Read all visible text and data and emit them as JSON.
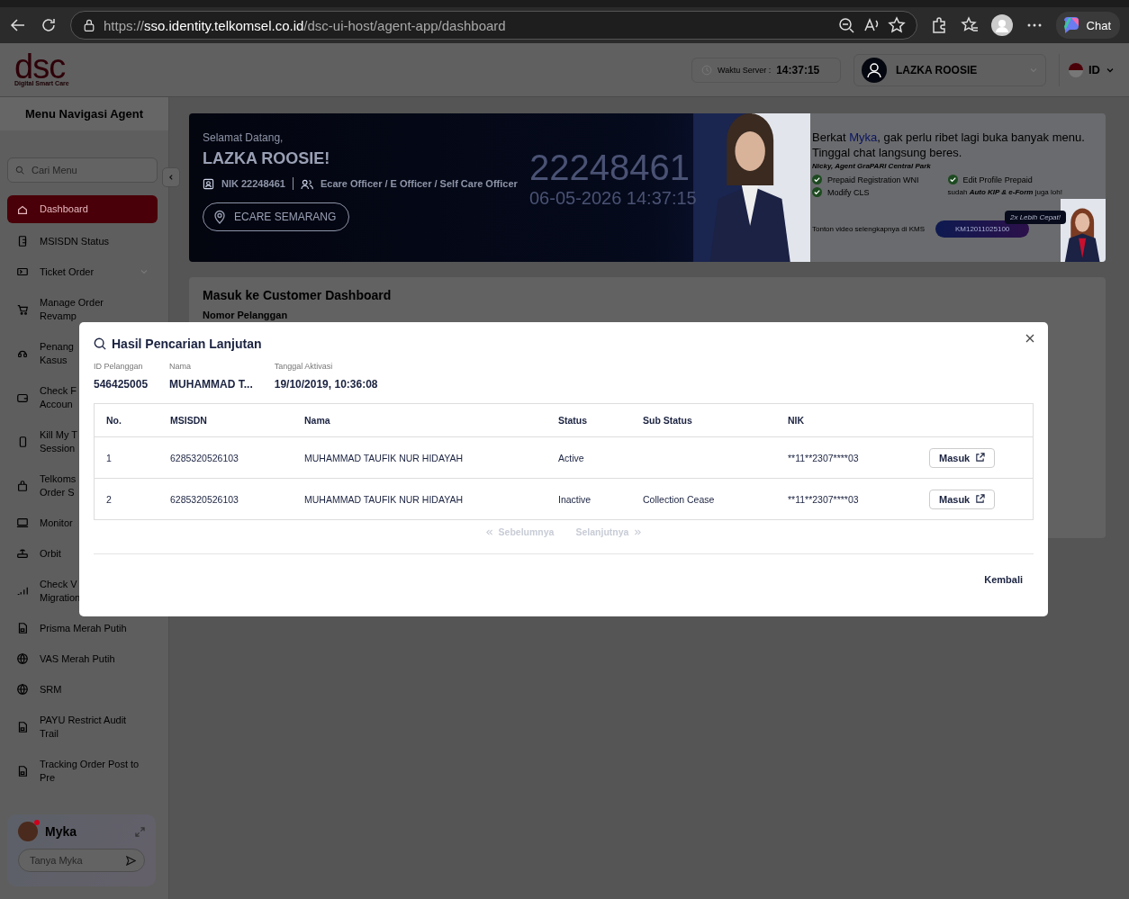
{
  "browser": {
    "url_scheme": "https://",
    "url_host": "sso.identity.telkomsel.co.id",
    "url_path": "/dsc-ui-host/agent-app/dashboard",
    "chat_label": "Chat"
  },
  "header": {
    "logo": "dsc",
    "logo_tagline": "Digital Smart Care",
    "server_time_label": "Waktu Server :",
    "server_time": "14:37:15",
    "user_name": "LAZKA ROOSIE",
    "language": "ID"
  },
  "sidebar": {
    "title": "Menu Navigasi Agent",
    "search_placeholder": "Cari Menu",
    "items": [
      {
        "label": "Dashboard",
        "kind": "link",
        "selected": true
      },
      {
        "label": "MSISDN Status",
        "kind": "link",
        "selected": false
      },
      {
        "label": "Ticket Order",
        "kind": "group",
        "selected": false
      },
      {
        "label": "Manage Order\nRevamp",
        "kind": "link",
        "selected": false
      },
      {
        "label": "Penang\nKasus",
        "kind": "link",
        "selected": false
      },
      {
        "label": "Check F\nAccoun",
        "kind": "link",
        "selected": false
      },
      {
        "label": "Kill My T\nSession",
        "kind": "link",
        "selected": false
      },
      {
        "label": "Telkoms\nOrder S",
        "kind": "link",
        "selected": false
      },
      {
        "label": "Monitor",
        "kind": "link",
        "selected": false
      },
      {
        "label": "Orbit",
        "kind": "link",
        "selected": false
      },
      {
        "label": "Check V\nMigration",
        "kind": "link",
        "selected": false
      },
      {
        "label": "Prisma Merah Putih",
        "kind": "link",
        "selected": false
      },
      {
        "label": "VAS Merah Putih",
        "kind": "link",
        "selected": false
      },
      {
        "label": "SRM",
        "kind": "link",
        "selected": false
      },
      {
        "label": "PAYU Restrict Audit\nTrail",
        "kind": "link",
        "selected": false
      },
      {
        "label": "Tracking Order Post to\nPre",
        "kind": "link",
        "selected": false
      }
    ],
    "assistant": {
      "name": "Myka",
      "placeholder": "Tanya Myka",
      "unread": true
    }
  },
  "banner": {
    "greeting": "Selamat Datang,",
    "name": "LAZKA ROOSIE!",
    "nik": "NIK 22248461",
    "roles": "Ecare Officer / E Officer / Self Care Officer",
    "location": "ECARE SEMARANG",
    "watermark_id": "22248461",
    "watermark_time": "06-05-2026 14:37:15",
    "promo": {
      "headline": "Berkat **Myka**, gak perlu ribet lagi buka banyak menu. Tinggal chat langsung beres.",
      "attribution": "Nicky, Agent GraPARI Central Park",
      "features": [
        "Prepaid Registration WNI",
        "Edit Profile Prepaid",
        "Modify CLS"
      ],
      "note": "sudah *Auto KIP & e-Form* juga loh!",
      "badge": "2x Lebih Cepat!",
      "video_text": "Tonton video selengkapnya di KMS",
      "kms_code": "KM12011025100"
    }
  },
  "customer_dashboard": {
    "title": "Masuk ke Customer Dashboard",
    "field_label": "Nomor Pelanggan"
  },
  "modal": {
    "title": "Hasil Pencarian Lanjutan",
    "summary": [
      {
        "label": "ID Pelanggan",
        "value": "546425005"
      },
      {
        "label": "Nama",
        "value": "MUHAMMAD T..."
      },
      {
        "label": "Tanggal Aktivasi",
        "value": "19/10/2019, 10:36:08"
      }
    ],
    "table": {
      "columns": [
        "No.",
        "MSISDN",
        "Nama",
        "Status",
        "Sub Status",
        "NIK"
      ],
      "rows": [
        {
          "no": "1",
          "msisdn": "6285320526103",
          "nama": "MUHAMMAD TAUFIK NUR HIDAYAH",
          "status": "Active",
          "nik": "**11**2307****03",
          "action": "Masuk"
        },
        {
          "no": "2",
          "msisdn": "6285320526103",
          "nama": "MUHAMMAD TAUFIK NUR HIDAYAH",
          "status": "Inactive",
          "sub_status": "Collection Cease",
          "nik": "**11**2307****03",
          "action": "Masuk"
        }
      ]
    },
    "pagination": {
      "prev": {
        "label": "Sebelumnya",
        "disabled": true
      },
      "next": {
        "label": "Selanjutnya",
        "disabled": true
      }
    },
    "back_button": "Kembali"
  }
}
